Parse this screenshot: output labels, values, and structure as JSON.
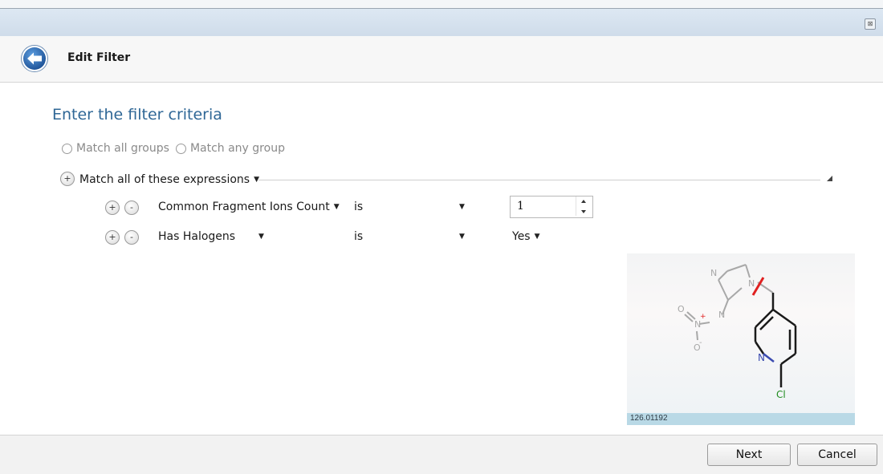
{
  "window": {
    "close_glyph": "⊠"
  },
  "header": {
    "title": "Edit Filter",
    "back_icon": "back-arrow-icon"
  },
  "main": {
    "title": "Enter the filter criteria",
    "group_mode_options": [
      {
        "label": "Match all groups",
        "selected": false
      },
      {
        "label": "Match any group",
        "selected": false
      }
    ],
    "expression_group": {
      "label": "Match all of these expressions",
      "add_glyph": "+",
      "rows": [
        {
          "add_glyph": "+",
          "remove_glyph": "-",
          "field": "Common Fragment Ions Count",
          "operator": "is",
          "value": "1"
        },
        {
          "add_glyph": "+",
          "remove_glyph": "-",
          "field": "Has Halogens",
          "operator": "is",
          "value": "Yes"
        }
      ]
    }
  },
  "structure_preview": {
    "mass": "126.01192",
    "atoms": {
      "n1": "N",
      "n2": "N",
      "n3": "N",
      "n4": "N",
      "o1": "O",
      "o2": "O",
      "cl": "Cl"
    },
    "colors": {
      "bond_faded": "#a8a8a8",
      "bond_dark": "#1a1a1a",
      "nitrogen": "#3b4bb0",
      "chlorine": "#1e8c1e",
      "cleavage": "#e02020"
    }
  },
  "footer": {
    "next_label": "Next",
    "cancel_label": "Cancel"
  },
  "colors": {
    "title_blue": "#2f6796",
    "header_bg": "#f7f7f7",
    "mass_strip": "#b9d9e6"
  }
}
